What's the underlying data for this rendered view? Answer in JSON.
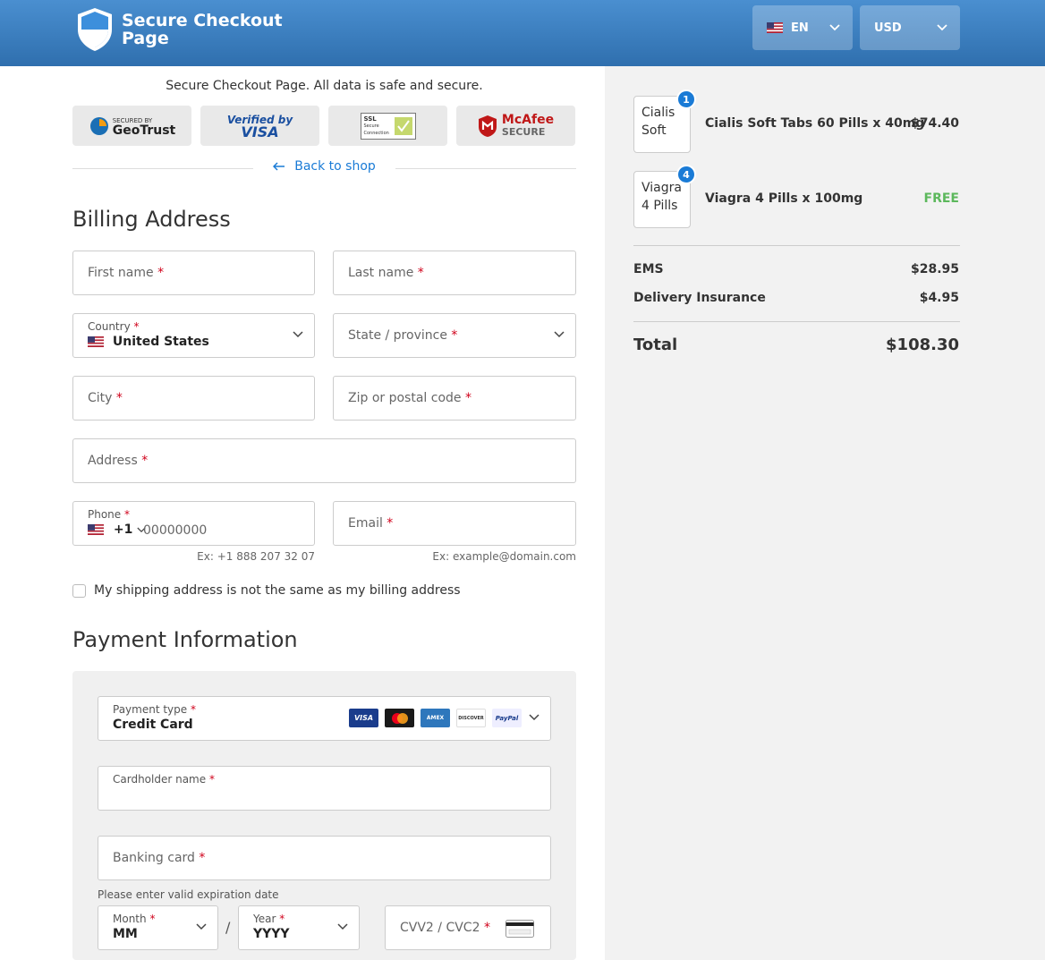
{
  "header": {
    "title_line1": "Secure Checkout",
    "title_line2": "Page",
    "language": "EN",
    "currency": "USD"
  },
  "secure_notice": "Secure Checkout Page. All data is safe and secure.",
  "badges": {
    "geotrust_small": "SECURED BY",
    "geotrust": "GeoTrust",
    "visa_top": "Verified by",
    "visa_bottom": "VISA",
    "ssl_top": "SSL",
    "ssl_bottom": "Secure Connection",
    "mcafee_top": "McAfee",
    "mcafee_bottom": "SECURE"
  },
  "back_link": "Back to shop",
  "billing": {
    "heading": "Billing Address",
    "first_name": "First name",
    "last_name": "Last name",
    "country_label": "Country",
    "country_value": "United States",
    "state": "State / province",
    "city": "City",
    "zip": "Zip or postal code",
    "address": "Address",
    "phone_label": "Phone",
    "phone_code": "+1",
    "phone_placeholder": "00000000",
    "phone_hint": "Ex: +1 888 207 32 07",
    "email": "Email",
    "email_hint": "Ex: example@domain.com",
    "required_mark": "*",
    "shipping_checkbox": "My shipping address is not the same as my billing address"
  },
  "payment": {
    "heading": "Payment Information",
    "type_label": "Payment type",
    "type_value": "Credit Card",
    "cardholder_label": "Cardholder name",
    "card_number": "Banking card",
    "expiry_hint": "Please enter valid expiration date",
    "month_label": "Month",
    "month_value": "MM",
    "year_label": "Year",
    "year_value": "YYYY",
    "slash": "/",
    "cvv": "CVV2 / CVC2",
    "card_logos": [
      "VISA",
      "MC",
      "AMEX",
      "DISCOVER",
      "PayPal"
    ]
  },
  "order": {
    "items": [
      {
        "thumb_text": "Cialis Soft",
        "qty": "1",
        "name": "Cialis Soft Tabs 60 Pills x 40mg",
        "price": "$74.40"
      },
      {
        "thumb_text": "Viagra 4 Pills",
        "qty": "4",
        "name": "Viagra 4 Pills x 100mg",
        "price": "FREE"
      }
    ],
    "shipping_label": "EMS",
    "shipping_price": "$28.95",
    "insurance_label": "Delivery Insurance",
    "insurance_price": "$4.95",
    "total_label": "Total",
    "total_price": "$108.30"
  },
  "colors": {
    "header": "#3a80c2",
    "link": "#1a7bd6",
    "required": "#d0021b",
    "free": "#5cb85c"
  }
}
